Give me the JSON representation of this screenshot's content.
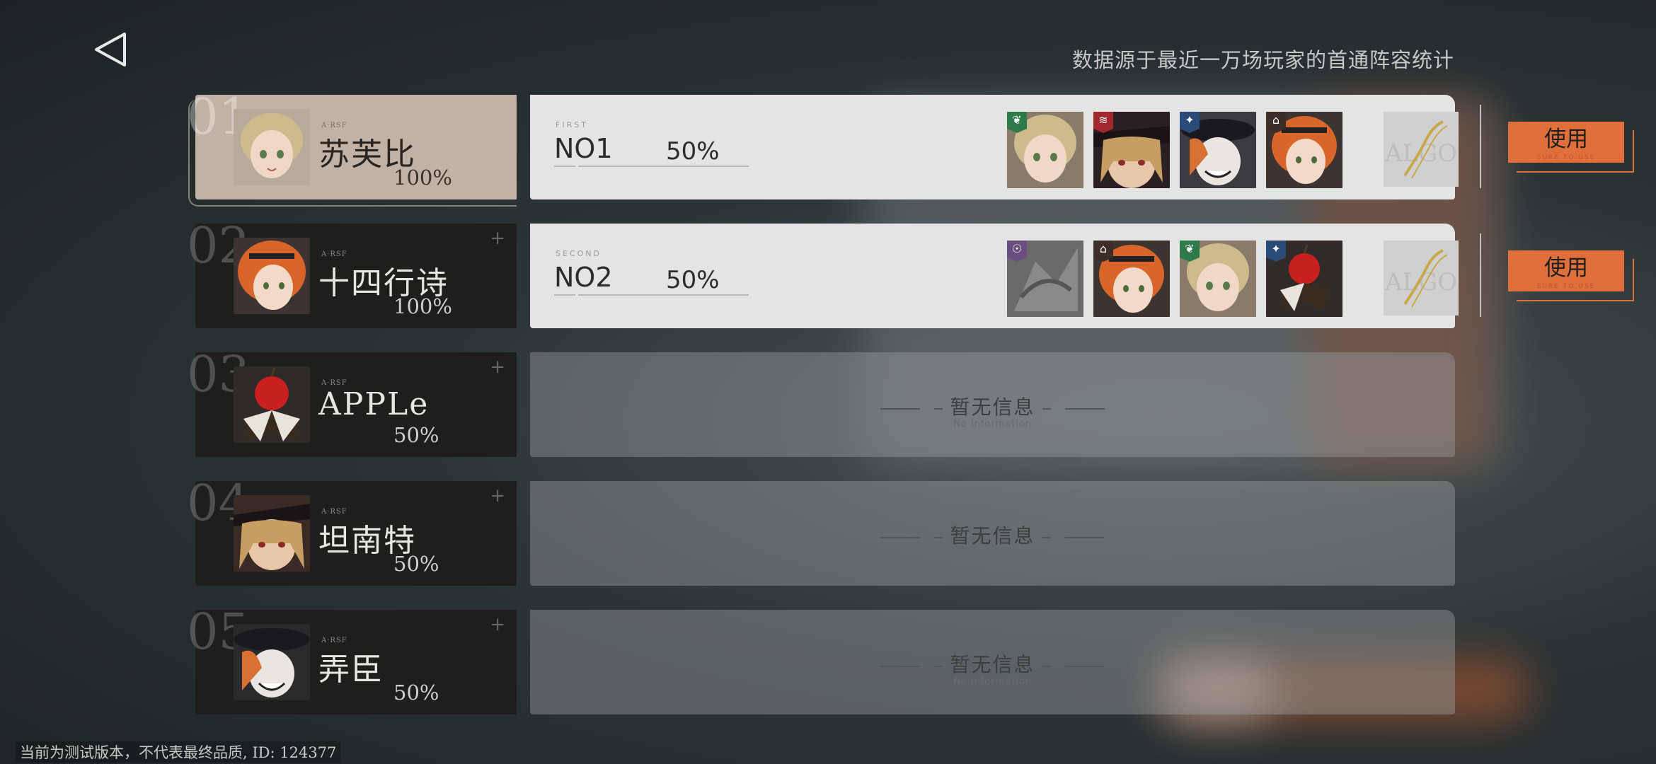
{
  "header": {
    "note": "数据源于最近一万场玩家的首通阵容统计"
  },
  "characters": [
    {
      "rank": "01",
      "tag": "A·RSF",
      "name": "苏芙比",
      "pct": "100%",
      "colors": {
        "hair": "#cdbb8e",
        "skin": "#f1d8c6",
        "bg": "#b9a99a"
      }
    },
    {
      "rank": "02",
      "tag": "A·RSF",
      "name": "十四行诗",
      "pct": "100%",
      "colors": {
        "hair": "#d8652a",
        "skin": "#f3d9c8",
        "bg": "#3b3431"
      }
    },
    {
      "rank": "03",
      "tag": "A·RSF",
      "name": "APPLe",
      "pct": "50%",
      "colors": {
        "hair": "#c8201e",
        "skin": "#e8e4dc",
        "bg": "#302a28"
      }
    },
    {
      "rank": "04",
      "tag": "A·RSF",
      "name": "坦南特",
      "pct": "50%",
      "colors": {
        "hair": "#c69d62",
        "skin": "#e8c6a8",
        "bg": "#3a2a26"
      }
    },
    {
      "rank": "05",
      "tag": "A·RSF",
      "name": "弄臣",
      "pct": "50%",
      "colors": {
        "hair": "#d87034",
        "skin": "#e9e6e2",
        "bg": "#2a2a2c"
      }
    }
  ],
  "teams": [
    {
      "ordinal_small": "FIRST",
      "ordinal": "NO1",
      "pct": "50%",
      "slots": [
        {
          "icon": "leaf-icon",
          "glyph": "❦",
          "badge": "#2e7a4a",
          "hair": "#cdbb8e",
          "skin": "#f1d8c6"
        },
        {
          "icon": "claw-icon",
          "glyph": "≋",
          "badge": "#a1282c",
          "hair": "#c69d62",
          "skin": "#e8c6a8"
        },
        {
          "icon": "star-icon",
          "glyph": "✦",
          "badge": "#2a4a78",
          "hair": "#d87034",
          "skin": "#e9e6e2"
        },
        {
          "icon": "lock-icon",
          "glyph": "⌂",
          "badge": "#3c2e28",
          "hair": "#d8652a",
          "skin": "#f3d9c8"
        }
      ],
      "item_label": "ALGO",
      "use_label": "使用",
      "use_sub": "SURE TO USE"
    },
    {
      "ordinal_small": "SECOND",
      "ordinal": "NO2",
      "pct": "50%",
      "slots": [
        {
          "icon": "spiral-icon",
          "glyph": "☉",
          "badge": "#6a4e80",
          "hair": "#7a7a7a",
          "skin": "#9c9c9c"
        },
        {
          "icon": "lock-icon",
          "glyph": "⌂",
          "badge": "#3c2e28",
          "hair": "#d8652a",
          "skin": "#f3d9c8"
        },
        {
          "icon": "leaf-icon",
          "glyph": "❦",
          "badge": "#2e7a4a",
          "hair": "#cdbb8e",
          "skin": "#f1d8c6"
        },
        {
          "icon": "star-icon",
          "glyph": "✦",
          "badge": "#2a4a78",
          "hair": "#c8201e",
          "skin": "#e8e4dc"
        }
      ],
      "item_label": "ALGO",
      "use_label": "使用",
      "use_sub": "SURE TO USE"
    }
  ],
  "empty": {
    "text": "暂无信息",
    "sub": "No information"
  },
  "footer": {
    "note": "当前为测试版本，不代表最终品质, ID: 124377"
  },
  "colors": {
    "accent": "#e06f3c",
    "active_card": "#c2b2a5"
  }
}
